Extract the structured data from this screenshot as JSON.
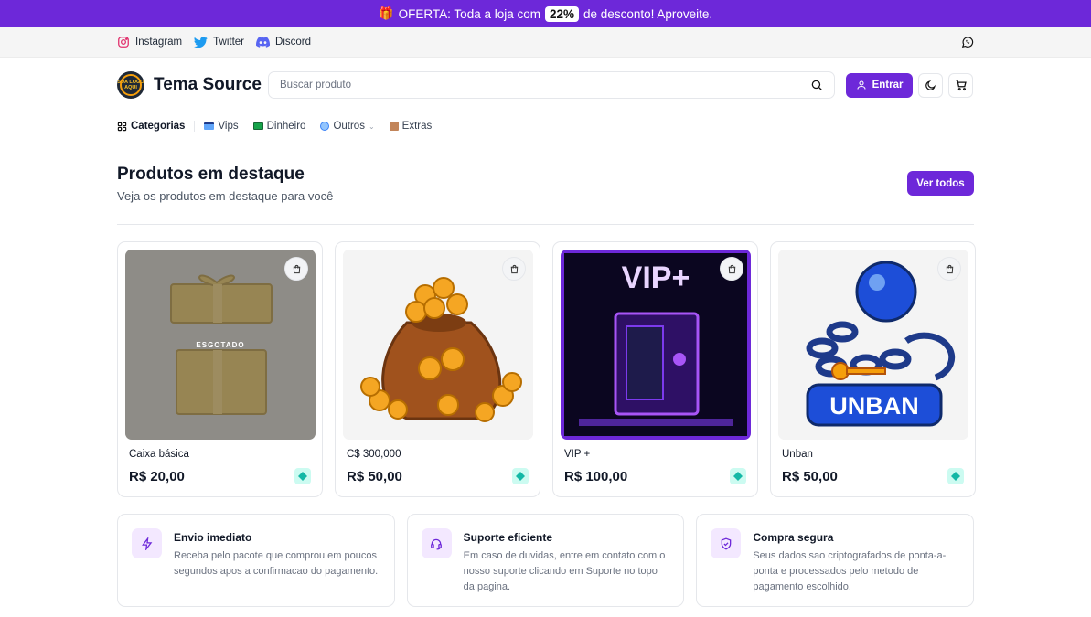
{
  "promo": {
    "icon": "gift-icon",
    "text_before": "OFERTA: Toda a loja com",
    "badge": "22%",
    "text_after": "de desconto! Aproveite.",
    "color": "#6d28d9"
  },
  "social": {
    "links": [
      {
        "label": "Instagram",
        "icon": "instagram-icon"
      },
      {
        "label": "Twitter",
        "icon": "twitter-icon"
      },
      {
        "label": "Discord",
        "icon": "discord-icon"
      }
    ],
    "whatsapp_icon": "whatsapp-icon"
  },
  "header": {
    "brand": "Tema Source",
    "logo_text": "SUA LOGO AQUI",
    "search_placeholder": "Buscar produto",
    "login_label": "Entrar",
    "accent": "#6d28d9"
  },
  "categories": [
    {
      "label": "Categorias",
      "icon": "grid-icon"
    },
    {
      "label": "Vips",
      "icon": "card-icon"
    },
    {
      "label": "Dinheiro",
      "icon": "money-icon"
    },
    {
      "label": "Outros",
      "icon": "globe-icon"
    },
    {
      "label": "Extras",
      "icon": "box-icon"
    }
  ],
  "featured": {
    "title": "Produtos em destaque",
    "subtitle": "Veja os produtos em destaque para você",
    "view_all": "Ver todos",
    "products": [
      {
        "name": "Caixa básica",
        "price": "R$ 20,00",
        "sold_out": "ESGOTADO"
      },
      {
        "name": "C$ 300,000",
        "price": "R$ 50,00"
      },
      {
        "name": "VIP +",
        "price": "R$ 100,00",
        "image_text": "VIP+"
      },
      {
        "name": "Unban",
        "price": "R$ 50,00",
        "image_text": "UNBAN"
      }
    ]
  },
  "features": [
    {
      "title": "Envio imediato",
      "text": "Receba pelo pacote que comprou em poucos segundos apos a confirmacao do pagamento.",
      "icon": "lightning-icon"
    },
    {
      "title": "Suporte eficiente",
      "text": "Em caso de duvidas, entre em contato com o nosso suporte clicando em Suporte no topo da pagina.",
      "icon": "headset-icon"
    },
    {
      "title": "Compra segura",
      "text": "Seus dados sao criptografados de ponta-a-ponta e processados pelo metodo de pagamento escolhido.",
      "icon": "shield-icon"
    }
  ]
}
